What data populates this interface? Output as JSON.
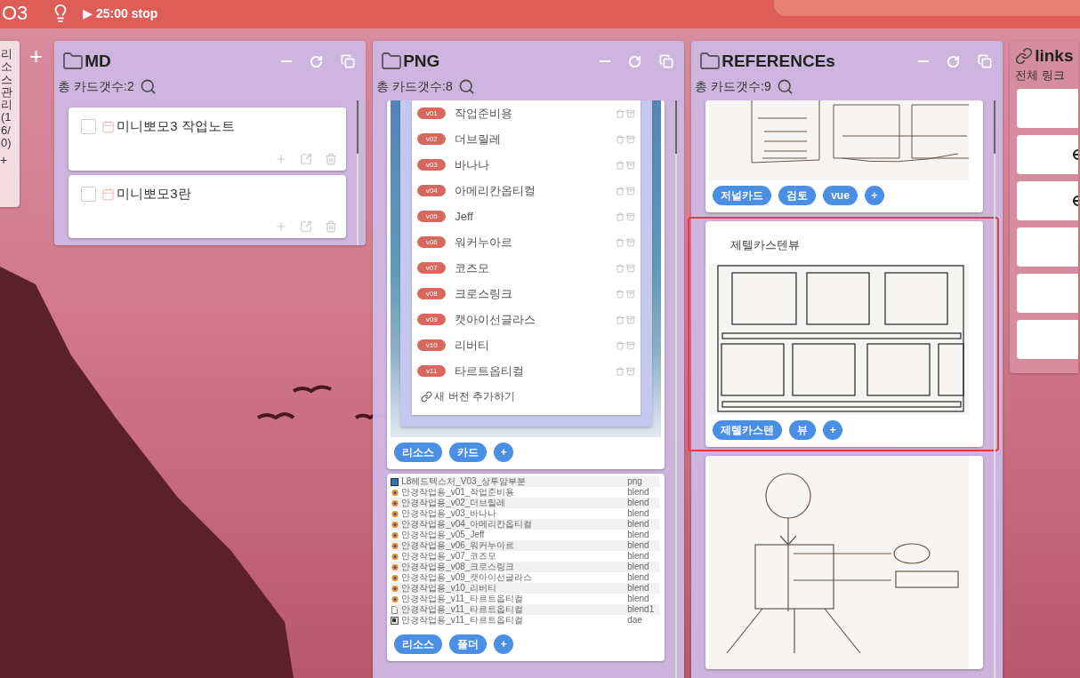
{
  "topbar": {
    "logo": "O3",
    "timer": "▶ 25:00 stop"
  },
  "side_panel": {
    "label": "리소스관리 (16/0)",
    "add": "+"
  },
  "add_column": "+",
  "columns": [
    {
      "title": "MD",
      "count_label": "총 카드갯수:2",
      "cards": [
        {
          "kind": "note",
          "title": "미니뽀모3 작업노트",
          "checked": false
        },
        {
          "kind": "note",
          "title": "미니뽀모3란",
          "checked": false
        }
      ]
    },
    {
      "title": "PNG",
      "count_label": "총 카드갯수:8",
      "cards": [
        {
          "kind": "versions",
          "versions": [
            {
              "tag": "v01",
              "name": "작업준비용"
            },
            {
              "tag": "v02",
              "name": "더브릴레"
            },
            {
              "tag": "v03",
              "name": "바나나"
            },
            {
              "tag": "v04",
              "name": "아메리칸옵티컬"
            },
            {
              "tag": "v05",
              "name": "Jeff"
            },
            {
              "tag": "v06",
              "name": "워커누아르"
            },
            {
              "tag": "v07",
              "name": "코즈모"
            },
            {
              "tag": "v08",
              "name": "크로스링크"
            },
            {
              "tag": "v09",
              "name": "캣아이선글라스"
            },
            {
              "tag": "v10",
              "name": "리버티"
            },
            {
              "tag": "v11",
              "name": "타르트옵티컬"
            }
          ],
          "add_label": "새 버전 추가하기",
          "tags": [
            "리소스",
            "카드"
          ],
          "add_tag": "+"
        },
        {
          "kind": "files",
          "files": [
            {
              "kind": "image",
              "name": "L8헤드텍스처_V03_상투암부분",
              "type": "png"
            },
            {
              "kind": "blend",
              "name": "안경작업용_v01_작업준비용",
              "type": "blend"
            },
            {
              "kind": "blend",
              "name": "안경작업용_v02_더브릴레",
              "type": "blend"
            },
            {
              "kind": "blend",
              "name": "안경작업용_v03_바나나",
              "type": "blend"
            },
            {
              "kind": "blend",
              "name": "안경작업용_v04_아메리칸옵티컬",
              "type": "blend"
            },
            {
              "kind": "blend",
              "name": "안경작업용_v05_Jeff",
              "type": "blend"
            },
            {
              "kind": "blend",
              "name": "안경작업용_v06_워커누아르",
              "type": "blend"
            },
            {
              "kind": "blend",
              "name": "안경작업용_v07_코즈모",
              "type": "blend"
            },
            {
              "kind": "blend",
              "name": "안경작업용_v08_크로스링크",
              "type": "blend"
            },
            {
              "kind": "blend",
              "name": "안경작업용_v09_캣아이선글라스",
              "type": "blend"
            },
            {
              "kind": "blend",
              "name": "안경작업용_v10_리버티",
              "type": "blend"
            },
            {
              "kind": "blend",
              "name": "안경작업용_v11_타르트옵티컬",
              "type": "blend"
            },
            {
              "kind": "file",
              "name": "안경작업용_v11_타르트옵티컬",
              "type": "blend1"
            },
            {
              "kind": "model",
              "name": "안경작업용_v11_타르트옵티컬",
              "type": "dae"
            }
          ],
          "tags": [
            "리소스",
            "폴더"
          ],
          "add_tag": "+"
        }
      ]
    },
    {
      "title": "REFERENCEs",
      "count_label": "총 카드갯수:9",
      "cards": [
        {
          "kind": "board-sketch",
          "selected": false,
          "tags": [
            "저널카드",
            "검토",
            "vue"
          ],
          "add_tag": "+"
        },
        {
          "kind": "wireframe-sketch",
          "selected": true,
          "title": "제텔카스텐뷰",
          "tags": [
            "제텔카스텐",
            "뷰"
          ],
          "add_tag": "+"
        },
        {
          "kind": "diagram-sketch",
          "selected": false
        }
      ]
    }
  ],
  "links": {
    "title": "links",
    "subtitle": "전체 링크",
    "cards": [
      {
        "icon": false
      },
      {
        "icon": true
      },
      {
        "icon": true
      },
      {
        "icon": false
      },
      {
        "icon": false
      },
      {
        "icon": false
      }
    ]
  }
}
